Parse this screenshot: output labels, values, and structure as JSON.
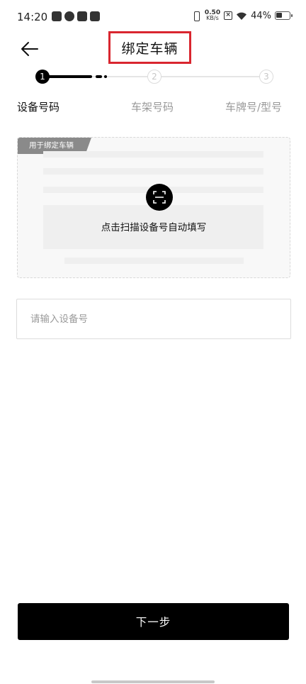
{
  "status_bar": {
    "time": "14:20",
    "net_speed_value": "0.50",
    "net_speed_unit": "KB/s",
    "battery_pct": "44%",
    "battery_level": 0.44,
    "app_icons": [
      "calendar-icon",
      "leaf-icon",
      "tiktok-icon",
      "mail-icon"
    ]
  },
  "header": {
    "title": "绑定车辆",
    "back_icon": "arrow-left-icon"
  },
  "stepper": {
    "current_step": 1,
    "steps": [
      {
        "number": "1",
        "label": "设备号码"
      },
      {
        "number": "2",
        "label": "车架号码"
      },
      {
        "number": "3",
        "label": "车牌号/型号"
      }
    ]
  },
  "scan_card": {
    "tag": "用于绑定车辆",
    "hint": "点击扫描设备号自动填写",
    "icon": "scan-icon"
  },
  "device_input": {
    "placeholder": "请输入设备号",
    "value": ""
  },
  "footer": {
    "next_label": "下一步"
  },
  "colors": {
    "primary": "#000000",
    "highlight_border": "#d9262f",
    "muted_text": "#999999"
  }
}
